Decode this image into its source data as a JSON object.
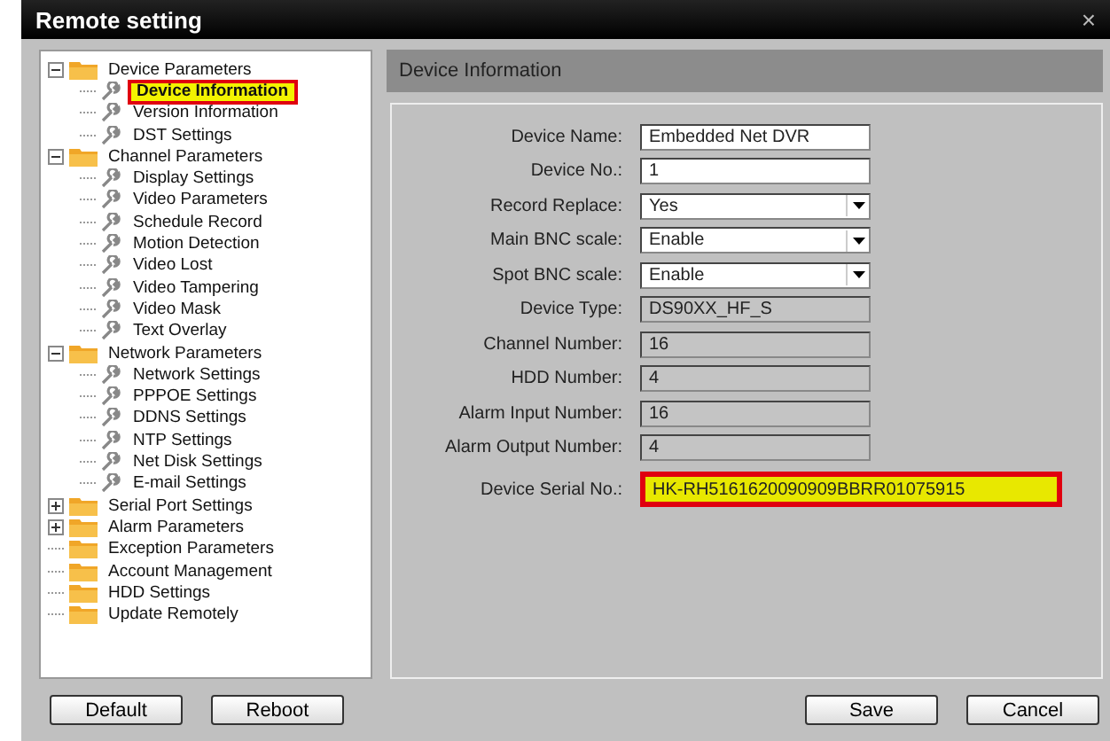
{
  "window": {
    "title": "Remote setting",
    "close": "×"
  },
  "tree": [
    {
      "label": "Device Parameters",
      "expanded": true,
      "children": [
        {
          "label": "Device Information",
          "selected": true
        },
        {
          "label": "Version Information",
          "selected": false
        },
        {
          "label": "DST Settings",
          "selected": false
        }
      ]
    },
    {
      "label": "Channel Parameters",
      "expanded": true,
      "children": [
        {
          "label": "Display Settings",
          "selected": false
        },
        {
          "label": "Video Parameters",
          "selected": false
        },
        {
          "label": "Schedule Record",
          "selected": false
        },
        {
          "label": "Motion Detection",
          "selected": false
        },
        {
          "label": "Video Lost",
          "selected": false
        },
        {
          "label": "Video Tampering",
          "selected": false
        },
        {
          "label": "Video Mask",
          "selected": false
        },
        {
          "label": "Text Overlay",
          "selected": false
        }
      ]
    },
    {
      "label": "Network Parameters",
      "expanded": true,
      "children": [
        {
          "label": "Network Settings",
          "selected": false
        },
        {
          "label": "PPPOE Settings",
          "selected": false
        },
        {
          "label": "DDNS Settings",
          "selected": false
        },
        {
          "label": "NTP Settings",
          "selected": false
        },
        {
          "label": "Net Disk Settings",
          "selected": false
        },
        {
          "label": "E-mail Settings",
          "selected": false
        }
      ]
    },
    {
      "label": "Serial Port Settings",
      "expanded": false
    },
    {
      "label": "Alarm Parameters",
      "expanded": false
    },
    {
      "label": "Exception Parameters"
    },
    {
      "label": "Account Management"
    },
    {
      "label": "HDD Settings"
    },
    {
      "label": "Update Remotely"
    }
  ],
  "panel": {
    "title": "Device Information",
    "fields": [
      {
        "label": "Device Name:",
        "kind": "text",
        "value": "Embedded Net DVR",
        "highlighted": false
      },
      {
        "label": "Device No.:",
        "kind": "text",
        "value": "1",
        "highlighted": false
      },
      {
        "label": "Record Replace:",
        "kind": "select",
        "value": "Yes",
        "highlighted": false
      },
      {
        "label": "Main BNC scale:",
        "kind": "select",
        "value": "Enable",
        "highlighted": false
      },
      {
        "label": "Spot BNC scale:",
        "kind": "select",
        "value": "Enable",
        "highlighted": false
      },
      {
        "label": "Device Type:",
        "kind": "readonly",
        "value": "DS90XX_HF_S",
        "highlighted": false
      },
      {
        "label": "Channel Number:",
        "kind": "readonly",
        "value": "16",
        "highlighted": false
      },
      {
        "label": "HDD Number:",
        "kind": "readonly",
        "value": "4",
        "highlighted": false
      },
      {
        "label": "Alarm Input Number:",
        "kind": "readonly",
        "value": "16",
        "highlighted": false
      },
      {
        "label": "Alarm Output Number:",
        "kind": "readonly",
        "value": "4",
        "highlighted": false
      },
      {
        "label": "Device Serial No.:",
        "kind": "readonly",
        "value": "HK-RH5161620090909BBRR01075915",
        "highlighted": true
      }
    ]
  },
  "buttons_left": [
    "Default",
    "Reboot"
  ],
  "buttons_right": [
    "Save",
    "Cancel"
  ]
}
